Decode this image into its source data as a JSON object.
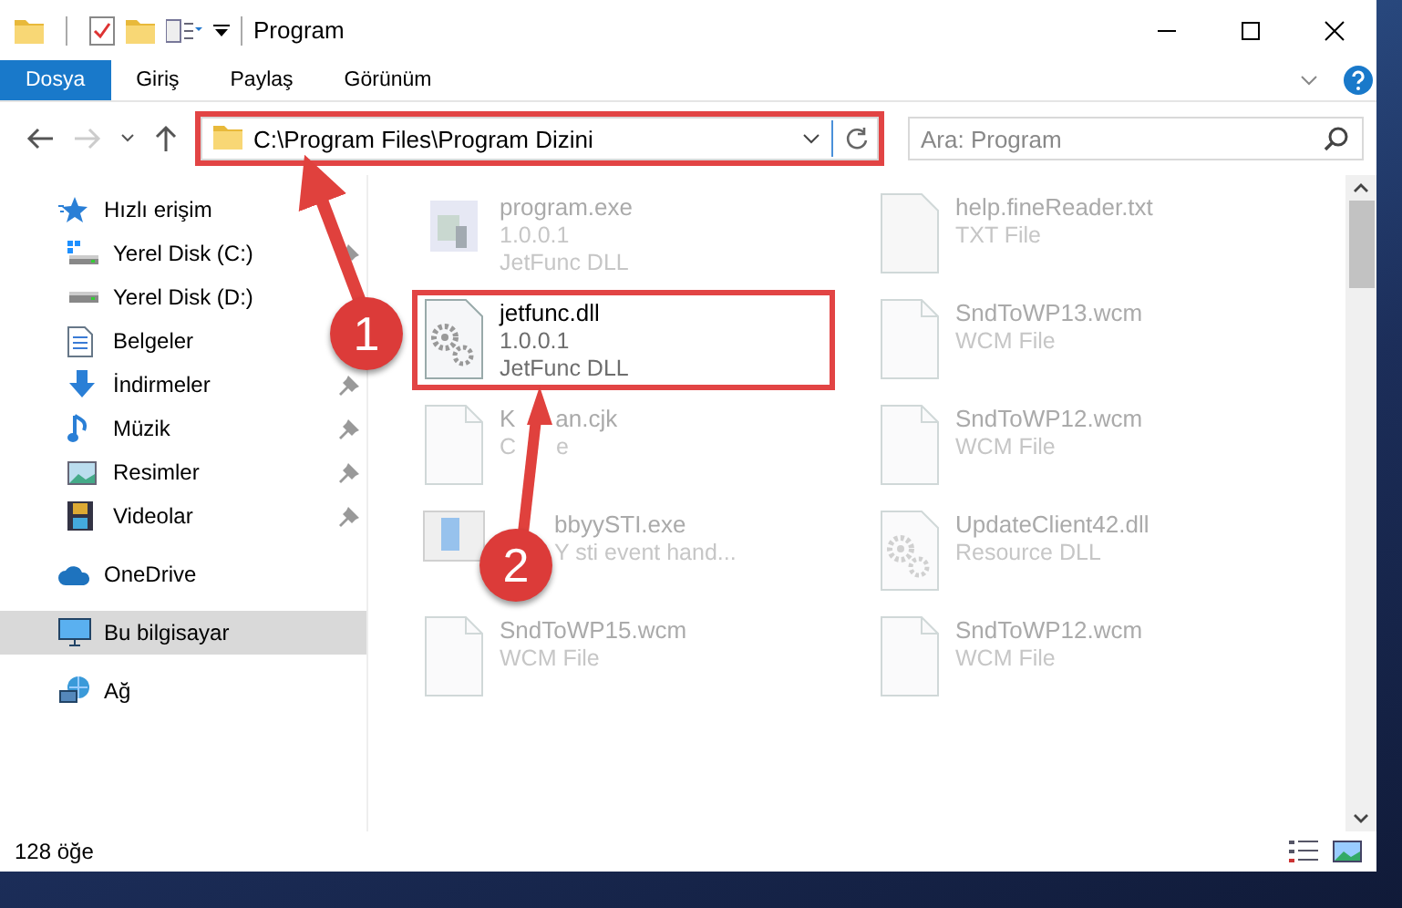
{
  "window": {
    "title": "Program"
  },
  "ribbon_tabs": [
    {
      "label": "Dosya",
      "selected": true
    },
    {
      "label": "Giriş",
      "selected": false
    },
    {
      "label": "Paylaş",
      "selected": false
    },
    {
      "label": "Görünüm",
      "selected": false
    }
  ],
  "address": {
    "path": "C:\\Program Files\\Program Dizini",
    "highlighted": true
  },
  "search": {
    "placeholder": "Ara: Program"
  },
  "sidebar": {
    "items": [
      {
        "label": "Hızlı erişim",
        "kind": "star",
        "selected": false,
        "pinned": false,
        "children": [
          {
            "label": "Yerel Disk (C:)",
            "kind": "drive-win",
            "selected": false,
            "pinned": true
          },
          {
            "label": "Yerel Disk (D:)",
            "kind": "drive",
            "selected": false,
            "pinned": false
          },
          {
            "label": "Belgeler",
            "kind": "document",
            "selected": false,
            "pinned": false
          },
          {
            "label": "İndirmeler",
            "kind": "download",
            "selected": false,
            "pinned": true
          },
          {
            "label": "Müzik",
            "kind": "music",
            "selected": false,
            "pinned": true
          },
          {
            "label": "Resimler",
            "kind": "image",
            "selected": false,
            "pinned": true
          },
          {
            "label": "Videolar",
            "kind": "video",
            "selected": false,
            "pinned": true
          }
        ]
      },
      {
        "label": "OneDrive",
        "kind": "cloud",
        "selected": false,
        "pinned": false
      },
      {
        "label": "Bu bilgisayar",
        "kind": "computer",
        "selected": true,
        "pinned": false
      },
      {
        "label": "Ağ",
        "kind": "network",
        "selected": false,
        "pinned": false
      }
    ]
  },
  "files": [
    {
      "name": [
        "program.exe"
      ],
      "lines": [
        [
          "1.0.0.1"
        ],
        [
          "JetFunc DLL"
        ]
      ],
      "kind": "app",
      "dimmed": true,
      "highlighted": false
    },
    {
      "name": [
        "jetfunc.dll"
      ],
      "lines": [
        [
          "1.0.0.1"
        ],
        [
          "JetFunc DLL"
        ]
      ],
      "kind": "gear",
      "dimmed": false,
      "highlighted": true
    },
    {
      "name": [
        "K",
        "an.cjk"
      ],
      "lines": [
        [
          "C",
          "e"
        ]
      ],
      "kind": "blank",
      "dimmed": true,
      "highlighted": false
    },
    {
      "name": [
        "bbyySTI.exe"
      ],
      "lines": [
        [
          "Y sti event hand..."
        ]
      ],
      "kind": "window",
      "dimmed": true,
      "highlighted": false
    },
    {
      "name": [
        "SndToWP15.wcm"
      ],
      "lines": [
        [
          "WCM File"
        ]
      ],
      "kind": "blank",
      "dimmed": true,
      "highlighted": false
    },
    {
      "name": [
        "help.fineReader.txt"
      ],
      "lines": [
        [
          "TXT File"
        ]
      ],
      "kind": "text",
      "dimmed": true,
      "highlighted": false
    },
    {
      "name": [
        "SndToWP13.wcm"
      ],
      "lines": [
        [
          "WCM File"
        ]
      ],
      "kind": "blank",
      "dimmed": true,
      "highlighted": false
    },
    {
      "name": [
        "SndToWP12.wcm"
      ],
      "lines": [
        [
          "WCM File"
        ]
      ],
      "kind": "blank",
      "dimmed": true,
      "highlighted": false
    },
    {
      "name": [
        "UpdateClient42.dll"
      ],
      "lines": [
        [
          "Resource DLL"
        ]
      ],
      "kind": "gear",
      "dimmed": true,
      "highlighted": false
    },
    {
      "name": [
        "SndToWP12.wcm"
      ],
      "lines": [
        [
          "WCM File"
        ]
      ],
      "kind": "blank",
      "dimmed": true,
      "highlighted": false
    }
  ],
  "status_bar": {
    "count": "128 öğe"
  },
  "annotations": [
    {
      "number": "1"
    },
    {
      "number": "2"
    }
  ]
}
